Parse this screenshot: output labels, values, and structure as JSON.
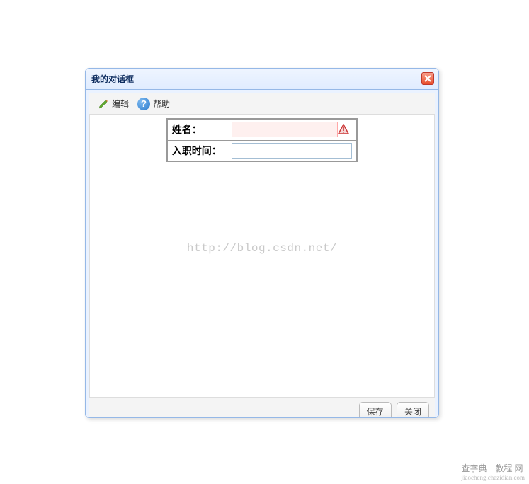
{
  "dialog": {
    "title": "我的对话框"
  },
  "toolbar": {
    "edit_label": "编辑",
    "help_label": "帮助"
  },
  "form": {
    "name_label": "姓名：",
    "name_value": "",
    "hiredate_label": "入职时间：",
    "hiredate_value": ""
  },
  "watermark": "http://blog.csdn.net/",
  "footer": {
    "save_label": "保存",
    "close_label": "关闭"
  },
  "page_footer": {
    "main": "查字典｜教程 网",
    "sub": "jiaocheng.chazidian.com"
  }
}
